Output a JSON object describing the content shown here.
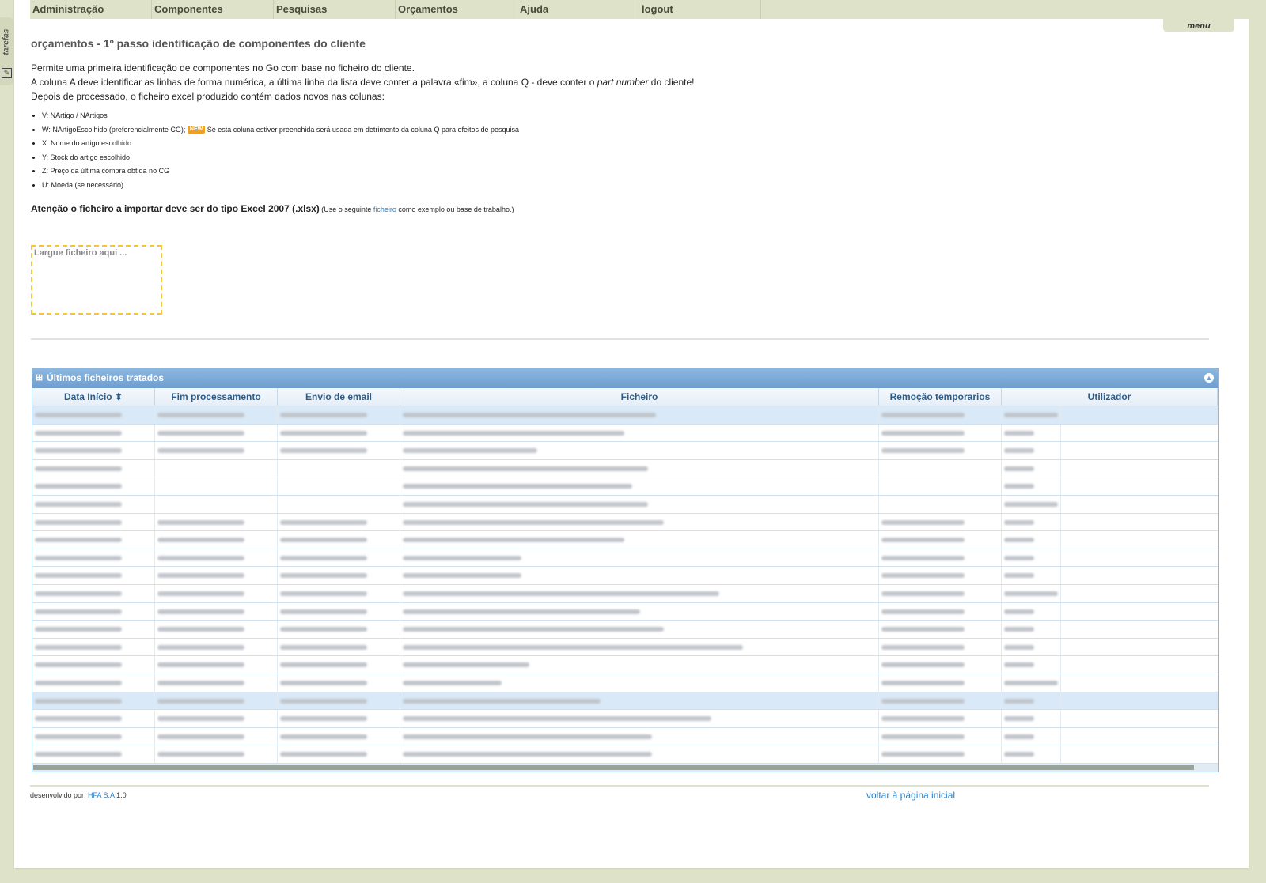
{
  "sidebar_tab": {
    "label": "tarefas",
    "icon": "note-icon"
  },
  "nav": {
    "items": [
      "Administração",
      "Componentes",
      "Pesquisas",
      "Orçamentos",
      "Ajuda",
      "logout"
    ],
    "menu_label": "menu"
  },
  "page": {
    "title": "orçamentos - 1º passo identificação de componentes do cliente",
    "intro": {
      "line1": "Permite uma primeira identificação de componentes no Go com base no ficheiro do cliente.",
      "line2_a": "A coluna A deve identificar as linhas de forma numérica, a última linha da lista deve conter a palavra «fim», a coluna Q - deve conter o ",
      "line2_em": "part number",
      "line2_b": " do cliente!",
      "line3": "Depois de processado, o ficheiro excel produzido contém dados novos nas colunas:"
    },
    "columns_list": [
      "V: NArtigo / NArtigos",
      "W: NArtigoEscolhido (preferencialmente CG);",
      "X: Nome do artigo escolhido",
      "Y: Stock do artigo escolhido",
      "Z: Preço da última compra obtida no CG",
      "U: Moeda (se necessário)"
    ],
    "new_badge": "NEW",
    "w_note": " Se esta coluna estiver preenchida será usada em detrimento da coluna Q para efeitos de pesquisa",
    "warning": {
      "bold": "Atenção o ficheiro a importar deve ser do tipo Excel 2007 (.xlsx)",
      "small_a": " (Use o seguinte ",
      "link": "ficheiro",
      "small_b": " como exemplo ou base de trabalho.)"
    },
    "dropzone": "Largue ficheiro aqui ..."
  },
  "grid": {
    "title": "Últimos ficheiros tratados",
    "columns": [
      "Data Início ⬍",
      "Fim processamento",
      "Envio de email",
      "Ficheiro",
      "Remoção temporarios",
      "Utilizador"
    ],
    "selected_rows": [
      0,
      16
    ]
  },
  "footer": {
    "dev_label": "desenvolvido por: ",
    "dev_link": "HFA S.A",
    "version": " 1.0",
    "home_link": "voltar à página inicial"
  },
  "colors": {
    "accent": "#2a7fc9",
    "grid_header": "#6f9fcf",
    "bg": "#dde2c8",
    "dropzone": "#f2c53a"
  }
}
